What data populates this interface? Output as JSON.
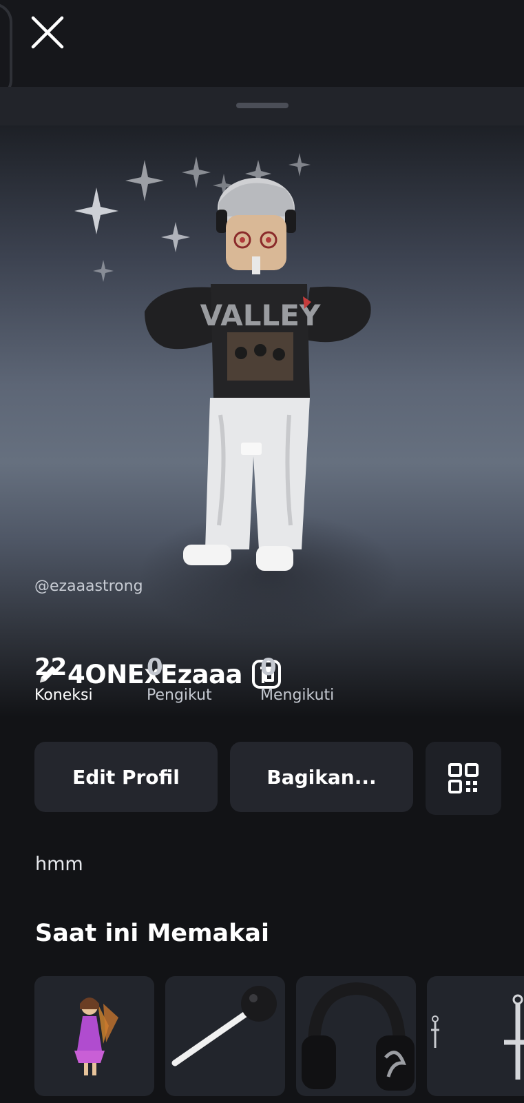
{
  "profile": {
    "display_name": "4ONExEzaaa",
    "username": "@ezaaastrong",
    "bio": "hmm"
  },
  "stats": [
    {
      "value": "22",
      "label": "Koneksi"
    },
    {
      "value": "0",
      "label": "Pengikut"
    },
    {
      "value": "0",
      "label": "Mengikuti"
    }
  ],
  "actions": {
    "edit_label": "Edit Profil",
    "share_label": "Bagikan..."
  },
  "wearing": {
    "title": "Saat ini Memakai",
    "items": [
      {
        "icon": "fairy-avatar-icon"
      },
      {
        "icon": "lollipop-icon"
      },
      {
        "icon": "headphones-icon"
      },
      {
        "icon": "cross-earrings-icon"
      }
    ]
  },
  "icons": {
    "close": "close-icon",
    "edit_name": "pencil-icon",
    "premium": "premium-badge-icon",
    "qr": "qr-code-icon"
  },
  "colors": {
    "background": "#121316",
    "button": "#24262d",
    "text": "#ffffff",
    "muted_text": "#c4c8d0"
  }
}
